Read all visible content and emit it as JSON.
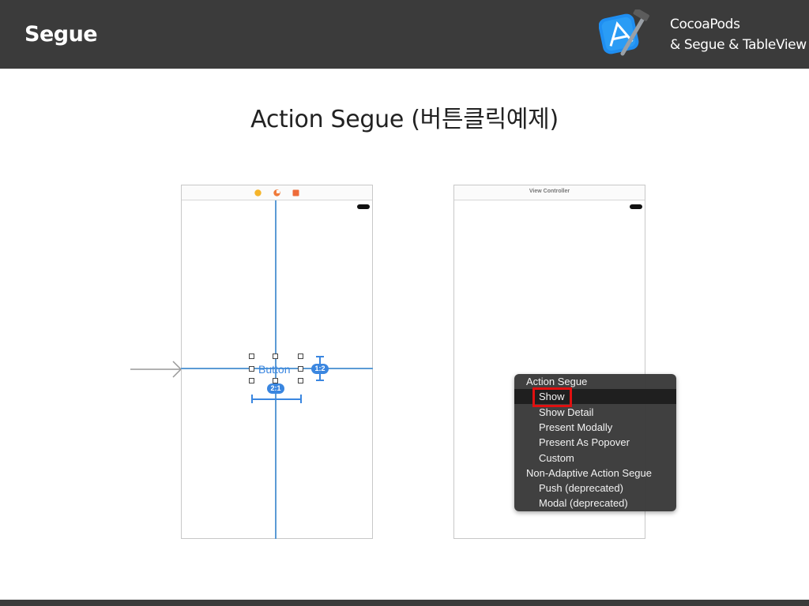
{
  "header": {
    "title": "Segue",
    "subtitle_line1": "CocoaPods",
    "subtitle_line2": "& Segue & TableView",
    "icon": "xcode-icon"
  },
  "slide": {
    "title": "Action Segue (버튼클릭예제)"
  },
  "left_scene": {
    "button_label": "Button",
    "badge_ratio": "1:2",
    "badge_width": "2:1",
    "colors": {
      "guide": "#5b9bd5",
      "accent": "#3a86e0"
    }
  },
  "right_scene": {
    "bar_title": "View Controller"
  },
  "menu": {
    "items": [
      {
        "label": "Action Segue",
        "kind": "header"
      },
      {
        "label": "Show",
        "kind": "option",
        "selected": true
      },
      {
        "label": "Show Detail",
        "kind": "option"
      },
      {
        "label": "Present Modally",
        "kind": "option"
      },
      {
        "label": "Present As Popover",
        "kind": "option"
      },
      {
        "label": "Custom",
        "kind": "option"
      },
      {
        "label": "Non-Adaptive Action Segue",
        "kind": "header"
      },
      {
        "label": "Push (deprecated)",
        "kind": "option"
      },
      {
        "label": "Modal (deprecated)",
        "kind": "option"
      }
    ],
    "highlight_color": "#e01010"
  }
}
